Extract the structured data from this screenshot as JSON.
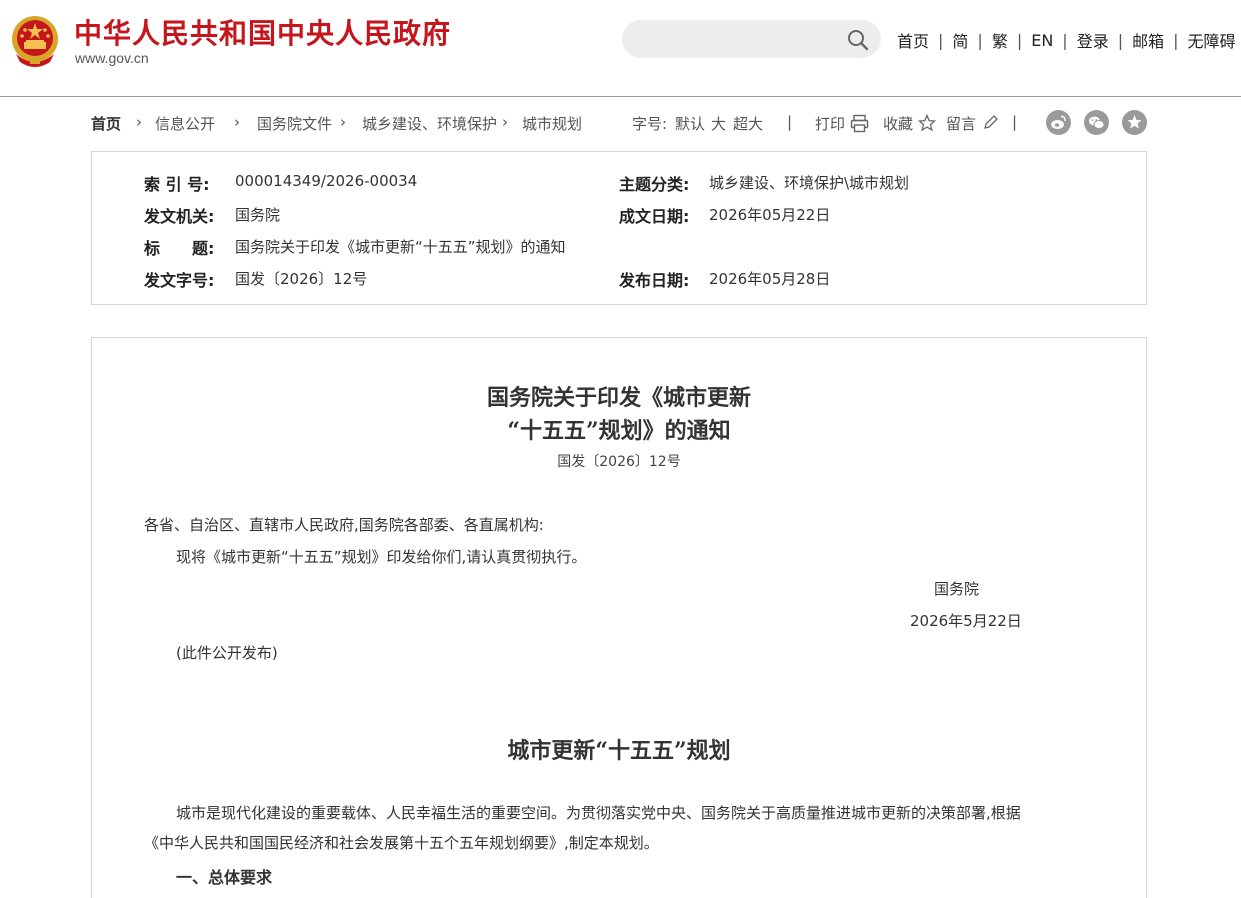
{
  "header": {
    "site_title": "中华人民共和国中央人民政府",
    "site_domain": "www.gov.cn",
    "search_placeholder": "",
    "nav": [
      "首页",
      "简",
      "繁",
      "EN",
      "登录",
      "邮箱",
      "无障碍"
    ],
    "nav_separator": "|"
  },
  "breadcrumb": {
    "items": [
      "首页",
      "信息公开",
      "国务院文件",
      "城乡建设、环境保护",
      "城市规划"
    ],
    "separator": "›"
  },
  "toolbar": {
    "font_size_label": "字号:",
    "font_default": "默认",
    "font_large": "大",
    "font_xlarge": "超大",
    "divider": "|",
    "print": "打印",
    "favorite": "收藏",
    "comment": "留言",
    "share_icons": [
      "weibo-icon",
      "wechat-icon",
      "star-icon"
    ]
  },
  "meta": {
    "index_label": "索 引 号:",
    "index_value": "000014349/2026-00034",
    "category_label": "主题分类:",
    "category_value": "城乡建设、环境保护\\城市规划",
    "issuer_label": "发文机关:",
    "issuer_value": "国务院",
    "written_date_label": "成文日期:",
    "written_date_value": "2026年05月22日",
    "title_label": "标　　题:",
    "title_value": "国务院关于印发《城市更新“十五五”规划》的通知",
    "doc_no_label": "发文字号:",
    "doc_no_value": "国发〔2026〕12号",
    "publish_date_label": "发布日期:",
    "publish_date_value": "2026年05月28日"
  },
  "article": {
    "title_line1": "国务院关于印发《城市更新",
    "title_line2": "“十五五”规划》的通知",
    "doc_no": "国发〔2026〕12号",
    "salutation": "各省、自治区、直辖市人民政府,国务院各部委、各直属机构:",
    "body": "现将《城市更新“十五五”规划》印发给你们,请认真贯彻执行。",
    "signer": "国务院",
    "date": "2026年5月22日",
    "note": "(此件公开发布)",
    "section_title": "城市更新“十五五”规划",
    "intro_line1": "城市是现代化建设的重要载体、人民幸福生活的重要空间。为贯彻落实党中央、国务院关于高质量推进城市更新的决策部署,根据",
    "intro_line2": "《中华人民共和国国民经济和社会发展第十五个五年规划纲要》,制定本规划。",
    "heading1": "一、总体要求"
  },
  "colors": {
    "brand_red": "#c4161c",
    "link_blue": "#1a4e8c",
    "border": "#d6d6d6",
    "icon_gray": "#9a9a9a"
  }
}
